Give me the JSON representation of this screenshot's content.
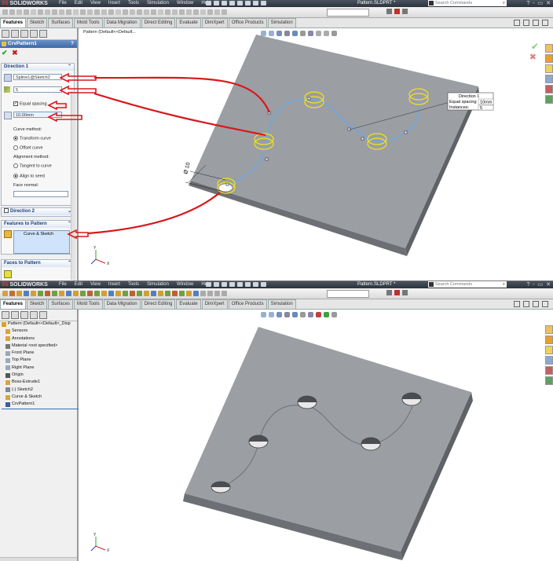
{
  "app": {
    "logo_prefix": "3S",
    "logo_text": "SOLIDWORKS",
    "menus": [
      "File",
      "Edit",
      "View",
      "Insert",
      "Tools",
      "Simulation",
      "Window",
      "Help"
    ],
    "document_title": "Pattern.SLDPRT *",
    "search_placeholder": "Search Commands",
    "window_controls": "? - ▭ ✕"
  },
  "tabs": [
    "Features",
    "Sketch",
    "Surfaces",
    "Mold Tools",
    "Data Migration",
    "Direct Editing",
    "Evaluate",
    "DimXpert",
    "Office Products",
    "Simulation"
  ],
  "active_tab": "Features",
  "property_manager": {
    "title": "CrvPattern1",
    "help": "?",
    "direction1": {
      "header": "Direction 1",
      "curve_value": "Spline1@Sketch2",
      "instances_value": "5",
      "equal_spacing_label": "Equal spacing",
      "spacing_value": "10.00mm",
      "curve_method_label": "Curve method:",
      "transform_curve": "Transform curve",
      "offset_curve": "Offset curve",
      "alignment_method_label": "Alignment method:",
      "tangent_to_curve": "Tangent to curve",
      "align_to_seed": "Align to seed",
      "face_normal_label": "Face normal:"
    },
    "direction2": {
      "header": "Direction 2"
    },
    "features_to_pattern": {
      "header": "Features to Pattern",
      "item": "Curve & Sketch"
    },
    "faces_to_pattern": {
      "header": "Faces to Pattern"
    }
  },
  "callout": {
    "line1": "Direction 1",
    "line2_label": "Equal spacing",
    "line2_value": "10mm",
    "line3_label": "Instances:",
    "line3_value": "5"
  },
  "dimension": "Ø 10",
  "breadcrumb": "Pattern  (Default<<Default...",
  "feature_tree": [
    {
      "label": "Pattern  (Default<<Default>_Disp",
      "icon": "part-icon",
      "color": "#e0a020"
    },
    {
      "label": "Sensors",
      "icon": "sensors-icon",
      "color": "#d4a640"
    },
    {
      "label": "Annotations",
      "icon": "annotations-icon",
      "color": "#d4a640"
    },
    {
      "label": "Material <not specified>",
      "icon": "material-icon",
      "color": "#777777"
    },
    {
      "label": "Front Plane",
      "icon": "plane-icon",
      "color": "#9aa8b8"
    },
    {
      "label": "Top Plane",
      "icon": "plane-icon",
      "color": "#9aa8b8"
    },
    {
      "label": "Right Plane",
      "icon": "plane-icon",
      "color": "#9aa8b8"
    },
    {
      "label": "Origin",
      "icon": "origin-icon",
      "color": "#555555"
    },
    {
      "label": "Boss-Extrude1",
      "icon": "extrude-icon",
      "color": "#d4a640"
    },
    {
      "label": "(-) Sketch2",
      "icon": "sketch-icon",
      "color": "#7a8a9a"
    },
    {
      "label": "Curve & Sketch",
      "icon": "folder-icon",
      "color": "#d4a640"
    },
    {
      "label": "CrvPattern1",
      "icon": "curve-pattern-icon",
      "color": "#3a5f9a"
    }
  ],
  "colors": {
    "plate_top": "#9b9ea3",
    "plate_side": "#5f6267",
    "spline": "#6aa8e8",
    "highlight": "#f4e21a",
    "arrow": "#d8181c",
    "titlebar": "#3d6aa8"
  }
}
